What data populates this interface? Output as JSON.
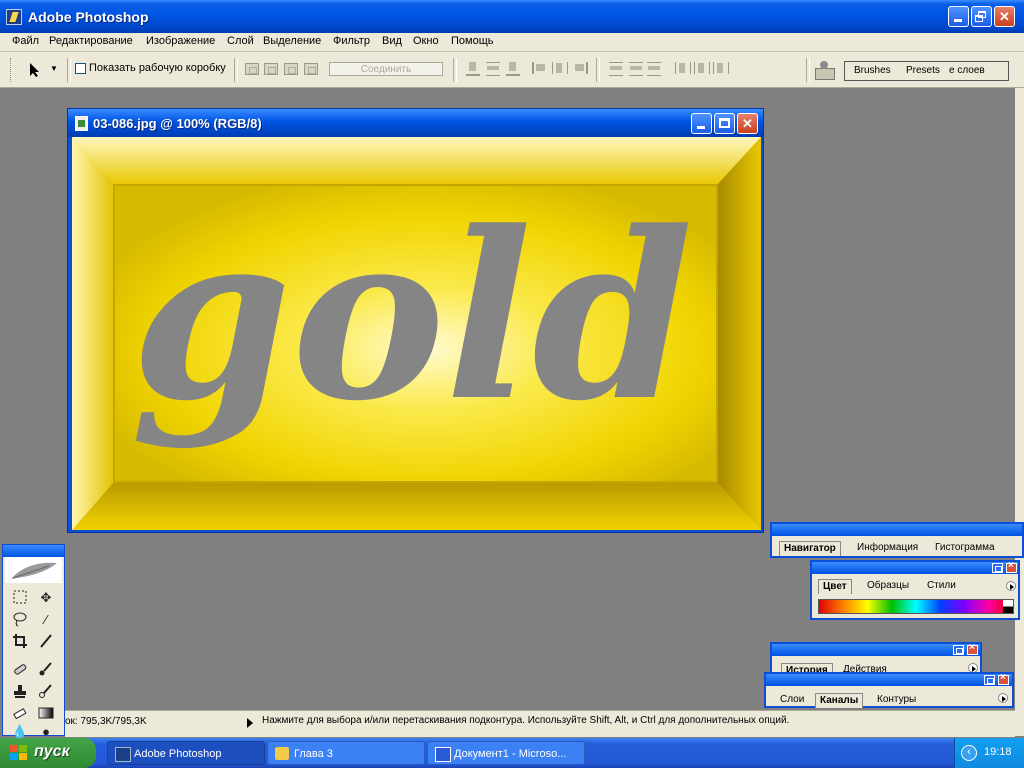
{
  "app": {
    "title": "Adobe Photoshop"
  },
  "menu": [
    "Файл",
    "Редактирование",
    "Изображение",
    "Слой",
    "Выделение",
    "Фильтр",
    "Вид",
    "Окно",
    "Помощь"
  ],
  "options": {
    "show_bbox_label": "Показать рабочую коробку",
    "join_button": "Соединить",
    "palette_tabs": [
      "Brushes",
      "Presets",
      "е слоев"
    ]
  },
  "document": {
    "title": "03-086.jpg @ 100% (RGB/8)",
    "artwork_text": "gold"
  },
  "status": {
    "doc_size": "ок: 795,3K/795,3K",
    "message": "Нажмите для выбора и/или перетаскивания подконтура.  Используйте Shift, Alt, и Ctrl для дополнительных опций."
  },
  "panels": {
    "navigator_tabs": [
      "Навигатор",
      "Информация",
      "Гистограмма"
    ],
    "color_tabs": [
      "Цвет",
      "Образцы",
      "Стили"
    ],
    "history_tabs": [
      "История",
      "Действия"
    ],
    "layers_tabs": [
      "Слои",
      "Каналы",
      "Контуры"
    ]
  },
  "taskbar": {
    "start": "пуск",
    "items": [
      "Adobe Photoshop",
      "Глава 3",
      "Документ1 - Microso..."
    ],
    "clock": "19:18"
  },
  "colors": {
    "xp_blue": "#0054e3",
    "gold": "#f2d600",
    "text_gray": "#808080"
  }
}
